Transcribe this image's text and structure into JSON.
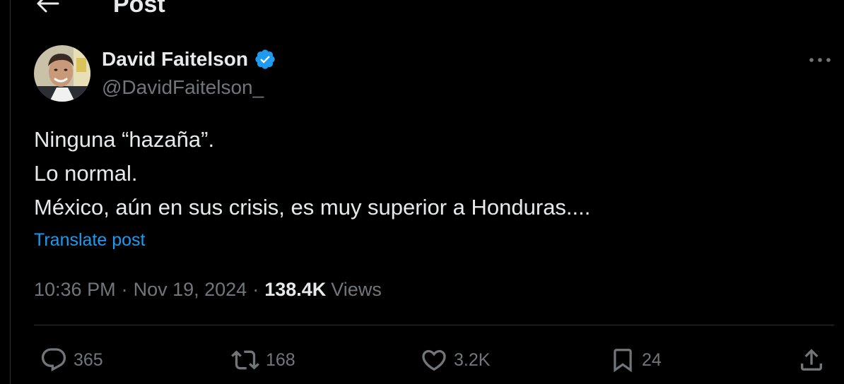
{
  "header": {
    "title": "Post",
    "back_icon": "arrow-left-icon"
  },
  "author": {
    "name": "David Faitelson",
    "handle": "@DavidFaitelson_",
    "verified_icon": "verified-badge-icon",
    "verified_color": "#1d9bf0"
  },
  "post": {
    "lines": [
      "Ninguna “hazaña”.",
      "Lo normal.",
      "México, aún en sus crisis, es muy superior a Honduras...."
    ],
    "translate_label": "Translate post"
  },
  "meta": {
    "time": "10:36 PM",
    "separator": "·",
    "date": "Nov 19, 2024",
    "views_count": "138.4K",
    "views_label": "Views"
  },
  "actions": {
    "replies": "365",
    "reposts": "168",
    "likes": "3.2K",
    "bookmarks": "24"
  },
  "colors": {
    "background": "#000000",
    "text_primary": "#e7e9ea",
    "text_secondary": "#71767b",
    "accent": "#1d9bf0",
    "border": "#2f3336"
  }
}
